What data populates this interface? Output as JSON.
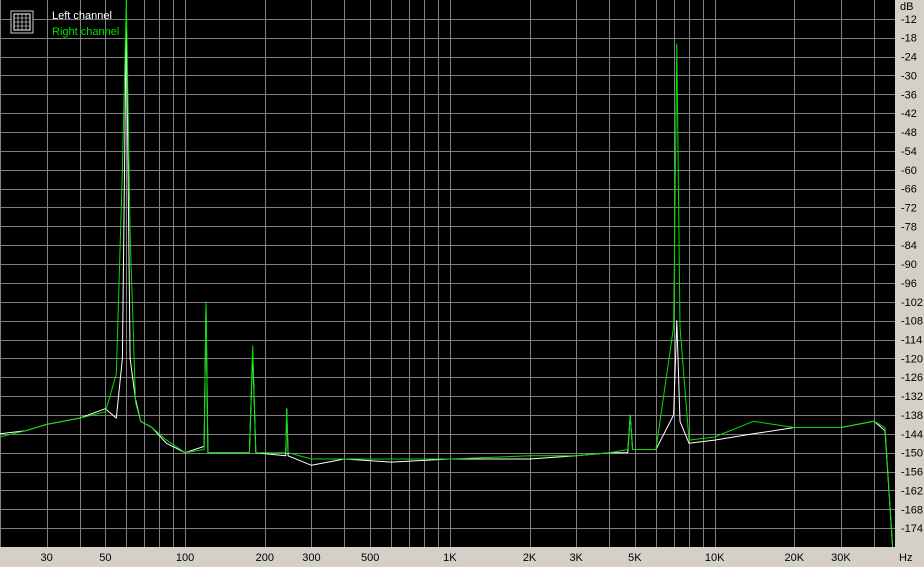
{
  "chart_data": {
    "type": "line",
    "title": "",
    "xlabel": "",
    "ylabel": "",
    "x_unit": "Hz",
    "y_unit": "dB",
    "x_scale": "log",
    "xlim": [
      20,
      48000
    ],
    "ylim": [
      -180,
      -6
    ],
    "grid": true,
    "legend_position": "top-left",
    "colors": {
      "background": "#000000",
      "grid": "#7f7f7f",
      "panel": "#d4d0c8",
      "left_channel": "#ffffff",
      "right_channel": "#00e000"
    },
    "x_tick_labels": [
      {
        "value": 30,
        "label": "30"
      },
      {
        "value": 50,
        "label": "50"
      },
      {
        "value": 100,
        "label": "100"
      },
      {
        "value": 200,
        "label": "200"
      },
      {
        "value": 300,
        "label": "300"
      },
      {
        "value": 500,
        "label": "500"
      },
      {
        "value": 1000,
        "label": "1K"
      },
      {
        "value": 2000,
        "label": "2K"
      },
      {
        "value": 3000,
        "label": "3K"
      },
      {
        "value": 5000,
        "label": "5K"
      },
      {
        "value": 10000,
        "label": "10K"
      },
      {
        "value": 20000,
        "label": "20K"
      },
      {
        "value": 30000,
        "label": "30K"
      }
    ],
    "y_tick_labels": [
      -12,
      -18,
      -24,
      -30,
      -36,
      -42,
      -48,
      -54,
      -60,
      -66,
      -72,
      -78,
      -84,
      -90,
      -96,
      -102,
      -108,
      -114,
      -120,
      -126,
      -132,
      -138,
      -144,
      -150,
      -156,
      -162,
      -168,
      -174
    ],
    "series": [
      {
        "name": "Left channel",
        "color": "#ffffff",
        "points": [
          [
            20,
            -144
          ],
          [
            25,
            -143
          ],
          [
            30,
            -141
          ],
          [
            40,
            -139
          ],
          [
            50,
            -136
          ],
          [
            55,
            -139
          ],
          [
            58,
            -120
          ],
          [
            60,
            -10
          ],
          [
            62,
            -120
          ],
          [
            65,
            -133
          ],
          [
            68,
            -140
          ],
          [
            75,
            -142
          ],
          [
            85,
            -147
          ],
          [
            100,
            -150
          ],
          [
            118,
            -148
          ],
          [
            120,
            -103
          ],
          [
            122,
            -150
          ],
          [
            175,
            -150
          ],
          [
            180,
            -118
          ],
          [
            185,
            -150
          ],
          [
            240,
            -151
          ],
          [
            242,
            -136
          ],
          [
            245,
            -151
          ],
          [
            300,
            -154
          ],
          [
            400,
            -152
          ],
          [
            600,
            -153
          ],
          [
            1000,
            -152
          ],
          [
            2000,
            -152
          ],
          [
            3000,
            -151
          ],
          [
            4000,
            -150
          ],
          [
            4700,
            -150
          ],
          [
            4800,
            -138
          ],
          [
            4900,
            -149
          ],
          [
            6000,
            -149
          ],
          [
            7000,
            -138
          ],
          [
            7200,
            -108
          ],
          [
            7400,
            -140
          ],
          [
            8000,
            -147
          ],
          [
            10000,
            -146
          ],
          [
            14000,
            -144
          ],
          [
            20000,
            -142
          ],
          [
            30000,
            -142
          ],
          [
            40000,
            -140
          ],
          [
            44000,
            -143
          ],
          [
            47000,
            -180
          ]
        ]
      },
      {
        "name": "Right channel",
        "color": "#00e000",
        "points": [
          [
            20,
            -145
          ],
          [
            25,
            -143
          ],
          [
            30,
            -141
          ],
          [
            40,
            -139
          ],
          [
            50,
            -137
          ],
          [
            55,
            -125
          ],
          [
            58,
            -60
          ],
          [
            60,
            -6
          ],
          [
            62,
            -80
          ],
          [
            65,
            -134
          ],
          [
            68,
            -140
          ],
          [
            75,
            -142
          ],
          [
            85,
            -146
          ],
          [
            100,
            -150
          ],
          [
            118,
            -149
          ],
          [
            120,
            -102
          ],
          [
            122,
            -150
          ],
          [
            175,
            -150
          ],
          [
            180,
            -116
          ],
          [
            185,
            -150
          ],
          [
            240,
            -150
          ],
          [
            242,
            -136
          ],
          [
            245,
            -150
          ],
          [
            300,
            -152
          ],
          [
            400,
            -152
          ],
          [
            600,
            -152
          ],
          [
            1000,
            -152
          ],
          [
            2000,
            -151
          ],
          [
            3000,
            -151
          ],
          [
            4000,
            -150
          ],
          [
            4700,
            -149
          ],
          [
            4800,
            -138
          ],
          [
            4900,
            -149
          ],
          [
            6000,
            -149
          ],
          [
            7000,
            -110
          ],
          [
            7200,
            -20
          ],
          [
            7400,
            -110
          ],
          [
            8000,
            -146
          ],
          [
            10000,
            -145
          ],
          [
            14000,
            -140
          ],
          [
            20000,
            -142
          ],
          [
            30000,
            -142
          ],
          [
            40000,
            -140
          ],
          [
            44000,
            -142
          ],
          [
            47000,
            -180
          ]
        ]
      }
    ]
  }
}
